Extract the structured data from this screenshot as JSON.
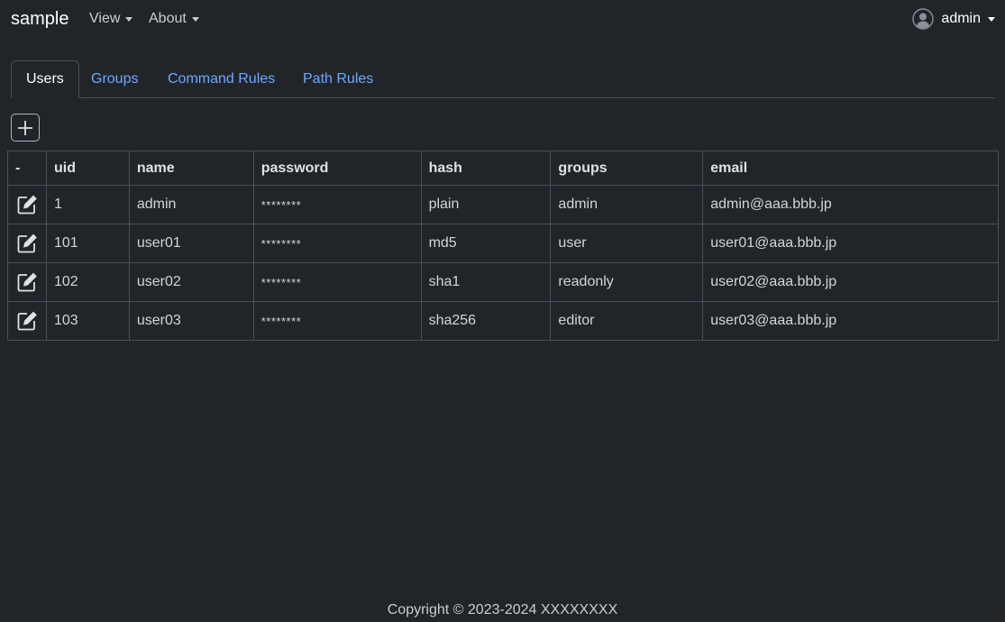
{
  "navbar": {
    "brand": "sample",
    "menu": [
      {
        "label": "View"
      },
      {
        "label": "About"
      }
    ],
    "user": {
      "name": "admin",
      "icon": "person-circle-icon"
    }
  },
  "tabs": [
    {
      "label": "Users",
      "active": true
    },
    {
      "label": "Groups",
      "active": false
    },
    {
      "label": "Command Rules",
      "active": false
    },
    {
      "label": "Path Rules",
      "active": false
    }
  ],
  "toolbar": {
    "add_icon": "plus-square-icon"
  },
  "table": {
    "columns": [
      "-",
      "uid",
      "name",
      "password",
      "hash",
      "groups",
      "email"
    ],
    "rows": [
      {
        "uid": "1",
        "name": "admin",
        "password": "********",
        "hash": "plain",
        "groups": "admin",
        "email": "admin@aaa.bbb.jp"
      },
      {
        "uid": "101",
        "name": "user01",
        "password": "********",
        "hash": "md5",
        "groups": "user",
        "email": "user01@aaa.bbb.jp"
      },
      {
        "uid": "102",
        "name": "user02",
        "password": "********",
        "hash": "sha1",
        "groups": "readonly",
        "email": "user02@aaa.bbb.jp"
      },
      {
        "uid": "103",
        "name": "user03",
        "password": "********",
        "hash": "sha256",
        "groups": "editor",
        "email": "user03@aaa.bbb.jp"
      }
    ]
  },
  "footer": {
    "copyright": "Copyright © 2023-2024 XXXXXXXX"
  },
  "colors": {
    "background": "#212529",
    "link": "#6ea8fe",
    "border": "#495057"
  }
}
